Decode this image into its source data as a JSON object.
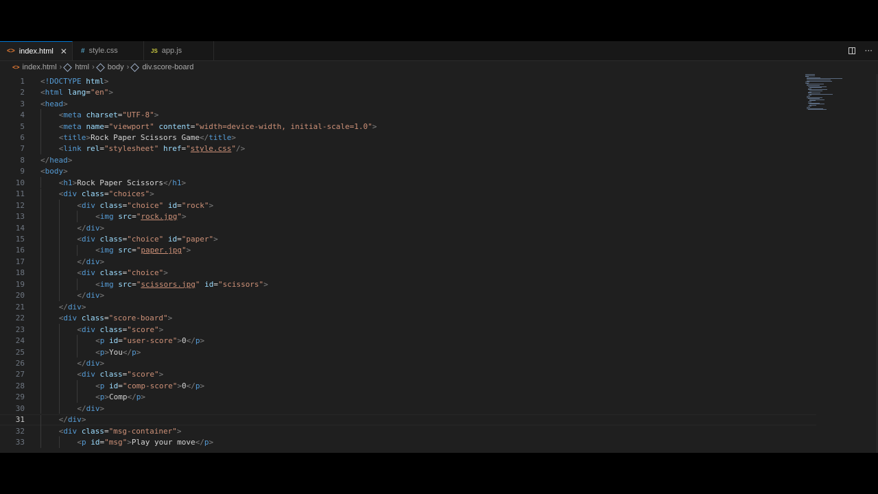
{
  "tabs": [
    {
      "label": "index.html",
      "icon_glyph": "<>",
      "icon_color": "#e37933",
      "close": "✕",
      "active": true
    },
    {
      "label": "style.css",
      "icon_glyph": "#",
      "icon_color": "#519aba",
      "active": false
    },
    {
      "label": "app.js",
      "icon_glyph": "JS",
      "icon_color": "#cbcb41",
      "active": false
    }
  ],
  "tab_actions": {
    "more": "···"
  },
  "breadcrumb": {
    "file": "index.html",
    "items": [
      "html",
      "body",
      "div.score-board"
    ],
    "separator": "›"
  },
  "current_line": 31,
  "code_lines": [
    {
      "n": "1",
      "indent": 0,
      "tokens": [
        [
          "punct",
          "<"
        ],
        [
          "tname",
          "!DOCTYPE"
        ],
        [
          "text",
          " "
        ],
        [
          "attr",
          "html"
        ],
        [
          "punct",
          ">"
        ]
      ]
    },
    {
      "n": "2",
      "indent": 0,
      "tokens": [
        [
          "punct",
          "<"
        ],
        [
          "tname",
          "html"
        ],
        [
          "text",
          " "
        ],
        [
          "attr",
          "lang"
        ],
        [
          "text",
          "="
        ],
        [
          "str",
          "\"en\""
        ],
        [
          "punct",
          ">"
        ]
      ]
    },
    {
      "n": "3",
      "indent": 0,
      "tokens": [
        [
          "punct",
          "<"
        ],
        [
          "tname",
          "head"
        ],
        [
          "punct",
          ">"
        ]
      ]
    },
    {
      "n": "4",
      "indent": 1,
      "tokens": [
        [
          "punct",
          "<"
        ],
        [
          "tname",
          "meta"
        ],
        [
          "text",
          " "
        ],
        [
          "attr",
          "charset"
        ],
        [
          "text",
          "="
        ],
        [
          "str",
          "\"UTF-8\""
        ],
        [
          "punct",
          ">"
        ]
      ]
    },
    {
      "n": "5",
      "indent": 1,
      "tokens": [
        [
          "punct",
          "<"
        ],
        [
          "tname",
          "meta"
        ],
        [
          "text",
          " "
        ],
        [
          "attr",
          "name"
        ],
        [
          "text",
          "="
        ],
        [
          "str",
          "\"viewport\""
        ],
        [
          "text",
          " "
        ],
        [
          "attr",
          "content"
        ],
        [
          "text",
          "="
        ],
        [
          "str",
          "\"width=device-width, initial-scale=1.0\""
        ],
        [
          "punct",
          ">"
        ]
      ]
    },
    {
      "n": "6",
      "indent": 1,
      "tokens": [
        [
          "punct",
          "<"
        ],
        [
          "tname",
          "title"
        ],
        [
          "punct",
          ">"
        ],
        [
          "text",
          "Rock Paper Scissors Game"
        ],
        [
          "punct",
          "</"
        ],
        [
          "tname",
          "title"
        ],
        [
          "punct",
          ">"
        ]
      ]
    },
    {
      "n": "7",
      "indent": 1,
      "tokens": [
        [
          "punct",
          "<"
        ],
        [
          "tname",
          "link"
        ],
        [
          "text",
          " "
        ],
        [
          "attr",
          "rel"
        ],
        [
          "text",
          "="
        ],
        [
          "str",
          "\"stylesheet\""
        ],
        [
          "text",
          " "
        ],
        [
          "attr",
          "href"
        ],
        [
          "text",
          "="
        ],
        [
          "str",
          "\""
        ],
        [
          "link",
          "style.css"
        ],
        [
          "str",
          "\""
        ],
        [
          "punct",
          "/>"
        ]
      ]
    },
    {
      "n": "8",
      "indent": 0,
      "tokens": [
        [
          "punct",
          "</"
        ],
        [
          "tname",
          "head"
        ],
        [
          "punct",
          ">"
        ]
      ]
    },
    {
      "n": "9",
      "indent": 0,
      "tokens": [
        [
          "punct",
          "<"
        ],
        [
          "tname",
          "body"
        ],
        [
          "punct",
          ">"
        ]
      ]
    },
    {
      "n": "10",
      "indent": 1,
      "tokens": [
        [
          "punct",
          "<"
        ],
        [
          "tname",
          "h1"
        ],
        [
          "punct",
          ">"
        ],
        [
          "text",
          "Rock Paper Scissors"
        ],
        [
          "punct",
          "</"
        ],
        [
          "tname",
          "h1"
        ],
        [
          "punct",
          ">"
        ]
      ]
    },
    {
      "n": "11",
      "indent": 1,
      "tokens": [
        [
          "punct",
          "<"
        ],
        [
          "tname",
          "div"
        ],
        [
          "text",
          " "
        ],
        [
          "attr",
          "class"
        ],
        [
          "text",
          "="
        ],
        [
          "str",
          "\"choices\""
        ],
        [
          "punct",
          ">"
        ]
      ]
    },
    {
      "n": "12",
      "indent": 2,
      "tokens": [
        [
          "punct",
          "<"
        ],
        [
          "tname",
          "div"
        ],
        [
          "text",
          " "
        ],
        [
          "attr",
          "class"
        ],
        [
          "text",
          "="
        ],
        [
          "str",
          "\"choice\""
        ],
        [
          "text",
          " "
        ],
        [
          "attr",
          "id"
        ],
        [
          "text",
          "="
        ],
        [
          "str",
          "\"rock\""
        ],
        [
          "punct",
          ">"
        ]
      ]
    },
    {
      "n": "13",
      "indent": 3,
      "tokens": [
        [
          "punct",
          "<"
        ],
        [
          "tname",
          "img"
        ],
        [
          "text",
          " "
        ],
        [
          "attr",
          "src"
        ],
        [
          "text",
          "="
        ],
        [
          "str",
          "\""
        ],
        [
          "link",
          "rock.jpg"
        ],
        [
          "str",
          "\""
        ],
        [
          "punct",
          ">"
        ]
      ]
    },
    {
      "n": "14",
      "indent": 2,
      "tokens": [
        [
          "punct",
          "</"
        ],
        [
          "tname",
          "div"
        ],
        [
          "punct",
          ">"
        ]
      ]
    },
    {
      "n": "15",
      "indent": 2,
      "tokens": [
        [
          "punct",
          "<"
        ],
        [
          "tname",
          "div"
        ],
        [
          "text",
          " "
        ],
        [
          "attr",
          "class"
        ],
        [
          "text",
          "="
        ],
        [
          "str",
          "\"choice\""
        ],
        [
          "text",
          " "
        ],
        [
          "attr",
          "id"
        ],
        [
          "text",
          "="
        ],
        [
          "str",
          "\"paper\""
        ],
        [
          "punct",
          ">"
        ]
      ]
    },
    {
      "n": "16",
      "indent": 3,
      "tokens": [
        [
          "punct",
          "<"
        ],
        [
          "tname",
          "img"
        ],
        [
          "text",
          " "
        ],
        [
          "attr",
          "src"
        ],
        [
          "text",
          "="
        ],
        [
          "str",
          "\""
        ],
        [
          "link",
          "paper.jpg"
        ],
        [
          "str",
          "\""
        ],
        [
          "punct",
          ">"
        ]
      ]
    },
    {
      "n": "17",
      "indent": 2,
      "tokens": [
        [
          "punct",
          "</"
        ],
        [
          "tname",
          "div"
        ],
        [
          "punct",
          ">"
        ]
      ]
    },
    {
      "n": "18",
      "indent": 2,
      "tokens": [
        [
          "punct",
          "<"
        ],
        [
          "tname",
          "div"
        ],
        [
          "text",
          " "
        ],
        [
          "attr",
          "class"
        ],
        [
          "text",
          "="
        ],
        [
          "str",
          "\"choice\""
        ],
        [
          "punct",
          ">"
        ]
      ]
    },
    {
      "n": "19",
      "indent": 3,
      "tokens": [
        [
          "punct",
          "<"
        ],
        [
          "tname",
          "img"
        ],
        [
          "text",
          " "
        ],
        [
          "attr",
          "src"
        ],
        [
          "text",
          "="
        ],
        [
          "str",
          "\""
        ],
        [
          "link",
          "scissors.jpg"
        ],
        [
          "str",
          "\""
        ],
        [
          "text",
          " "
        ],
        [
          "attr",
          "id"
        ],
        [
          "text",
          "="
        ],
        [
          "str",
          "\"scissors\""
        ],
        [
          "punct",
          ">"
        ]
      ]
    },
    {
      "n": "20",
      "indent": 2,
      "tokens": [
        [
          "punct",
          "</"
        ],
        [
          "tname",
          "div"
        ],
        [
          "punct",
          ">"
        ]
      ]
    },
    {
      "n": "21",
      "indent": 1,
      "tokens": [
        [
          "punct",
          "</"
        ],
        [
          "tname",
          "div"
        ],
        [
          "punct",
          ">"
        ]
      ]
    },
    {
      "n": "22",
      "indent": 1,
      "tokens": [
        [
          "punct",
          "<"
        ],
        [
          "tname",
          "div"
        ],
        [
          "text",
          " "
        ],
        [
          "attr",
          "class"
        ],
        [
          "text",
          "="
        ],
        [
          "str",
          "\"score-board\""
        ],
        [
          "punct",
          ">"
        ]
      ]
    },
    {
      "n": "23",
      "indent": 2,
      "tokens": [
        [
          "punct",
          "<"
        ],
        [
          "tname",
          "div"
        ],
        [
          "text",
          " "
        ],
        [
          "attr",
          "class"
        ],
        [
          "text",
          "="
        ],
        [
          "str",
          "\"score\""
        ],
        [
          "punct",
          ">"
        ]
      ]
    },
    {
      "n": "24",
      "indent": 3,
      "tokens": [
        [
          "punct",
          "<"
        ],
        [
          "tname",
          "p"
        ],
        [
          "text",
          " "
        ],
        [
          "attr",
          "id"
        ],
        [
          "text",
          "="
        ],
        [
          "str",
          "\"user-score\""
        ],
        [
          "punct",
          ">"
        ],
        [
          "text",
          "0"
        ],
        [
          "punct",
          "</"
        ],
        [
          "tname",
          "p"
        ],
        [
          "punct",
          ">"
        ]
      ]
    },
    {
      "n": "25",
      "indent": 3,
      "tokens": [
        [
          "punct",
          "<"
        ],
        [
          "tname",
          "p"
        ],
        [
          "punct",
          ">"
        ],
        [
          "text",
          "You"
        ],
        [
          "punct",
          "</"
        ],
        [
          "tname",
          "p"
        ],
        [
          "punct",
          ">"
        ]
      ]
    },
    {
      "n": "26",
      "indent": 2,
      "tokens": [
        [
          "punct",
          "</"
        ],
        [
          "tname",
          "div"
        ],
        [
          "punct",
          ">"
        ]
      ]
    },
    {
      "n": "27",
      "indent": 2,
      "tokens": [
        [
          "punct",
          "<"
        ],
        [
          "tname",
          "div"
        ],
        [
          "text",
          " "
        ],
        [
          "attr",
          "class"
        ],
        [
          "text",
          "="
        ],
        [
          "str",
          "\"score\""
        ],
        [
          "punct",
          ">"
        ]
      ]
    },
    {
      "n": "28",
      "indent": 3,
      "tokens": [
        [
          "punct",
          "<"
        ],
        [
          "tname",
          "p"
        ],
        [
          "text",
          " "
        ],
        [
          "attr",
          "id"
        ],
        [
          "text",
          "="
        ],
        [
          "str",
          "\"comp-score\""
        ],
        [
          "punct",
          ">"
        ],
        [
          "text",
          "0"
        ],
        [
          "punct",
          "</"
        ],
        [
          "tname",
          "p"
        ],
        [
          "punct",
          ">"
        ]
      ]
    },
    {
      "n": "29",
      "indent": 3,
      "tokens": [
        [
          "punct",
          "<"
        ],
        [
          "tname",
          "p"
        ],
        [
          "punct",
          ">"
        ],
        [
          "text",
          "Comp"
        ],
        [
          "punct",
          "</"
        ],
        [
          "tname",
          "p"
        ],
        [
          "punct",
          ">"
        ]
      ]
    },
    {
      "n": "30",
      "indent": 2,
      "tokens": [
        [
          "punct",
          "</"
        ],
        [
          "tname",
          "div"
        ],
        [
          "punct",
          ">"
        ]
      ]
    },
    {
      "n": "31",
      "indent": 1,
      "tokens": [
        [
          "punct",
          "</"
        ],
        [
          "tname",
          "div"
        ],
        [
          "punct",
          ">"
        ]
      ]
    },
    {
      "n": "32",
      "indent": 1,
      "tokens": [
        [
          "punct",
          "<"
        ],
        [
          "tname",
          "div"
        ],
        [
          "text",
          " "
        ],
        [
          "attr",
          "class"
        ],
        [
          "text",
          "="
        ],
        [
          "str",
          "\"msg-container\""
        ],
        [
          "punct",
          ">"
        ]
      ]
    },
    {
      "n": "33",
      "indent": 2,
      "tokens": [
        [
          "punct",
          "<"
        ],
        [
          "tname",
          "p"
        ],
        [
          "text",
          " "
        ],
        [
          "attr",
          "id"
        ],
        [
          "text",
          "="
        ],
        [
          "str",
          "\"msg\""
        ],
        [
          "punct",
          ">"
        ],
        [
          "text",
          "Play your move"
        ],
        [
          "punct",
          "</"
        ],
        [
          "tname",
          "p"
        ],
        [
          "punct",
          ">"
        ]
      ]
    }
  ],
  "colors": {
    "punct": "#808080",
    "tname": "#569cd6",
    "attr": "#9cdcfe",
    "str": "#ce9178",
    "text": "#d4d4d4",
    "accent": "#0078d4"
  }
}
